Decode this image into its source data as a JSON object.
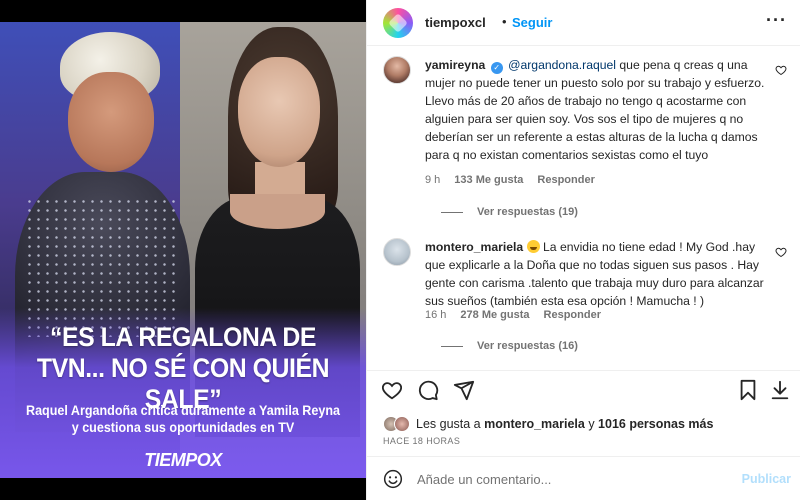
{
  "post": {
    "headline": "“ES LA REGALONA DE TVN... NO SÉ CON QUIÉN SALE”",
    "subhead": "Raquel Argandoña critica duramente a Yamila Reyna y cuestiona sus oportunidades en TV",
    "brand": "TIEMPOX"
  },
  "header": {
    "username": "tiempoxcl",
    "dot": "•",
    "follow_label": "Seguir",
    "more_icon": "more-icon"
  },
  "comments": [
    {
      "username": "yamireyna",
      "mention": "@argandona.raquel",
      "text": " que pena q creas q una mujer no puede tener un puesto solo por su trabajo y esfuerzo. Llevo más de 20 años de trabajo no tengo q acostarme con alguien para ser quien soy. Vos sos el tipo de mujeres q no deberían ser un referente a estas alturas de la lucha q damos para q no existan comentarios sexistas como el tuyo",
      "time": "9 h",
      "likes": "133 Me gusta",
      "reply": "Responder",
      "view_replies": "Ver respuestas (19)"
    },
    {
      "username": "montero_mariela",
      "text": " La envidia no tiene edad ! My God .hay que explicarle a la Doña que no todas siguen sus pasos . Hay gente con carisma .talento que trabaja muy duro para alcanzar sus sueños (también esta esa opción ! Mamucha ! )",
      "time": "16 h",
      "likes": "278 Me gusta",
      "reply": "Responder",
      "view_replies": "Ver respuestas (16)"
    }
  ],
  "likes_summary": {
    "prefix": "Les gusta a ",
    "user": "montero_mariela",
    "middle": " y ",
    "count": "1016 personas más"
  },
  "timestamp": "HACE 18 HORAS",
  "composer": {
    "placeholder": "Añade un comentario...",
    "post_label": "Publicar"
  },
  "colors": {
    "accent": "#0095f6",
    "post_disabled": "#b2dffc",
    "secondary_text": "#737373"
  }
}
